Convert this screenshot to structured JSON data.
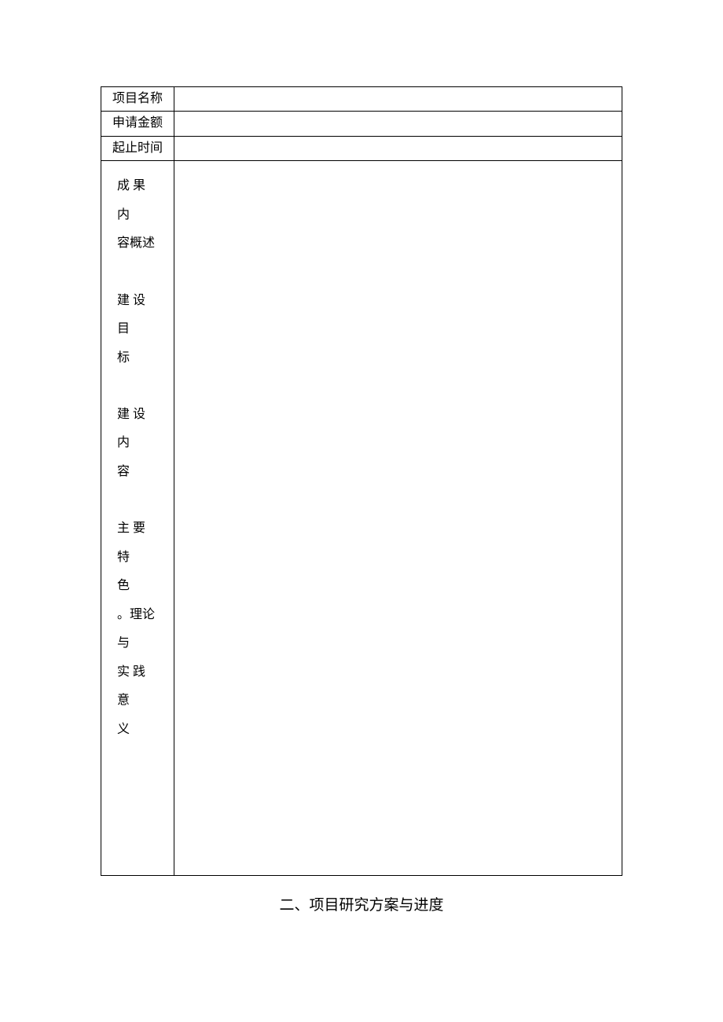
{
  "form": {
    "rows": [
      {
        "label": "项目名称",
        "value": ""
      },
      {
        "label": "申请金额",
        "value": ""
      },
      {
        "label": "起止时间",
        "value": ""
      }
    ],
    "overview": {
      "labels": {
        "results_summary_line1": "成 果 内",
        "results_summary_line2": "容概述",
        "build_goal_line1": "建 设 目",
        "build_goal_line2": "标",
        "build_content_line1": "建 设 内",
        "build_content_line2": "容",
        "features_line1": "主 要 特",
        "features_line2": "色",
        "theory_practice_line1": "。理论与",
        "theory_practice_line2": "实 践 意",
        "theory_practice_line3": "义"
      },
      "value": ""
    }
  },
  "section_heading": "二、项目研究方案与进度"
}
